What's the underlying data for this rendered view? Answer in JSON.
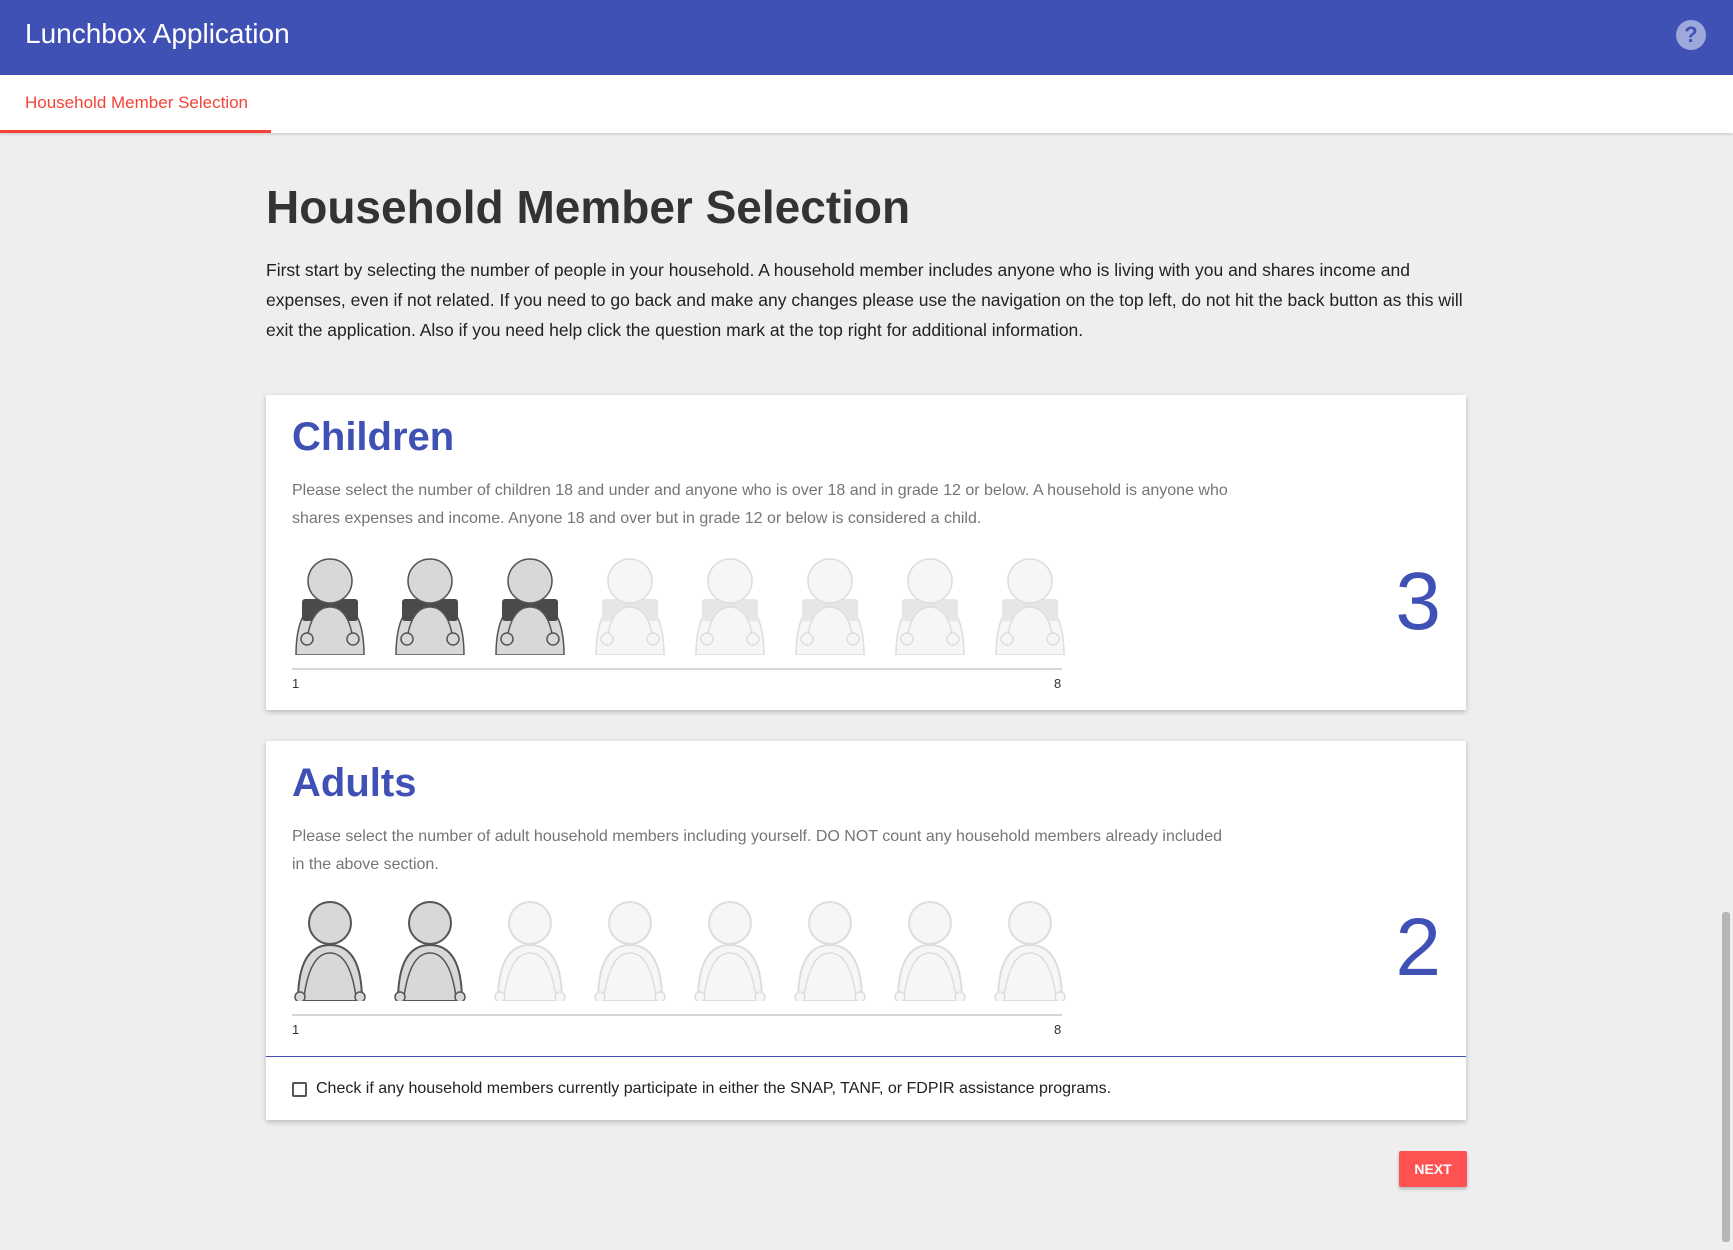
{
  "app_bar": {
    "title": "Lunchbox Application",
    "help_icon": "question-circle-icon",
    "help_glyph": "?"
  },
  "tabs": [
    {
      "label": "Household Member Selection",
      "active": true
    }
  ],
  "page": {
    "title": "Household Member Selection",
    "intro": "First start by selecting the number of people in your household. A household member includes anyone who is living with you and shares income and expenses, even if not related. If you need to go back and make any changes please use the navigation on the top left, do not hit the back button as this will exit the application. Also if you need help click the question mark at the top right for additional information."
  },
  "children": {
    "heading": "Children",
    "description": "Please select the number of children 18 and under and anyone who is over 18 and in grade 12 or below. A household is anyone who shares expenses and income. Anyone 18 and over but in grade 12 or below is considered a child.",
    "icon": "child-figure-icon",
    "max": 8,
    "selected": 3,
    "slider_min_label": "1",
    "slider_max_label": "8",
    "count": "3"
  },
  "adults": {
    "heading": "Adults",
    "description": "Please select the number of adult household members including yourself. DO NOT count any household members already included in the above section.",
    "icon": "adult-figure-icon",
    "max": 8,
    "selected": 2,
    "slider_min_label": "1",
    "slider_max_label": "8",
    "count": "2"
  },
  "assistance": {
    "checked": false,
    "label": "Check if any household members currently participate in either the SNAP, TANF, or FDPIR assistance programs."
  },
  "next_button": {
    "label": "NEXT"
  },
  "colors": {
    "primary": "#3f51b5",
    "accent": "#f44336",
    "button": "#ff5252",
    "background": "#eeeeee"
  }
}
